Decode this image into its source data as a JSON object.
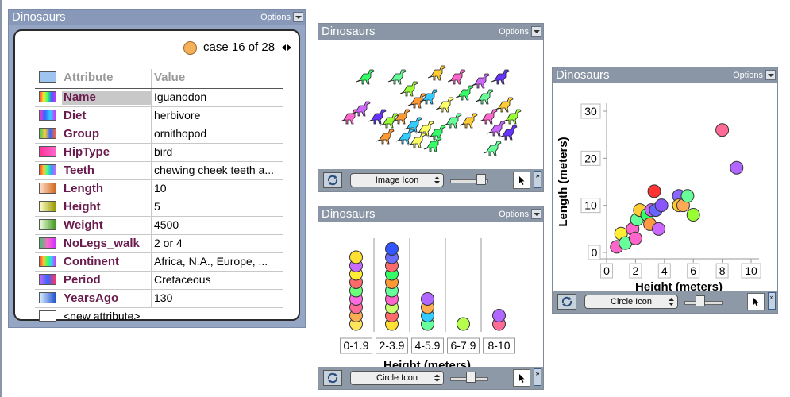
{
  "case_card": {
    "title": "Dinosaurs",
    "options_label": "Options",
    "case_text": "case 16 of 28",
    "header": {
      "attribute": "Attribute",
      "value": "Value"
    },
    "rows": [
      {
        "name": "Name",
        "value": "Iguanodon",
        "swatch": [
          "#ff3333",
          "#ffee33",
          "#33ff66",
          "#3366ff",
          "#cc33ff"
        ]
      },
      {
        "name": "Diet",
        "value": "herbivore",
        "swatch": [
          "#ff33cc",
          "#3366ff",
          "#33ccff",
          "#cc33ff"
        ]
      },
      {
        "name": "Group",
        "value": "ornithopod",
        "swatch": [
          "#33cc66",
          "#ffcc33",
          "#3366ff",
          "#ff6633"
        ]
      },
      {
        "name": "HipType",
        "value": "bird",
        "swatch": [
          "#ff3399",
          "#ff66cc"
        ]
      },
      {
        "name": "Teeth",
        "value": "chewing cheek teeth a...",
        "swatch": [
          "#ff3333",
          "#ffcc33",
          "#33ff99",
          "#3399ff",
          "#cc66ff"
        ]
      },
      {
        "name": "Length",
        "value": "10",
        "swatch": [
          "#ffe0cc",
          "#d2691e"
        ]
      },
      {
        "name": "Height",
        "value": "5",
        "swatch": [
          "#ffffcc",
          "#999900"
        ]
      },
      {
        "name": "Weight",
        "value": "4500",
        "swatch": [
          "#eeffdd",
          "#449922"
        ]
      },
      {
        "name": "NoLegs_walk",
        "value": "2 or 4",
        "swatch": [
          "#33cc66",
          "#ff66cc",
          "#cc33ff"
        ]
      },
      {
        "name": "Continent",
        "value": "Africa, N.A., Europe, ...",
        "swatch": [
          "#ff3333",
          "#ffcc33",
          "#33ff66",
          "#33ccff",
          "#cc33ff"
        ]
      },
      {
        "name": "Period",
        "value": "Cretaceous",
        "swatch": [
          "#cc66ff",
          "#3366ff",
          "#ff3366"
        ]
      },
      {
        "name": "YearsAgo",
        "value": "130",
        "swatch": [
          "#ddeeff",
          "#2255cc"
        ]
      }
    ],
    "new_attribute": "<new attribute>"
  },
  "image_panel": {
    "title": "Dinosaurs",
    "options_label": "Options",
    "select_value": "Image Icon",
    "colors": [
      "#33ff66",
      "#66ff99",
      "#ffcc33",
      "#ff66cc",
      "#cc66ff",
      "#6633ff",
      "#99ff33",
      "#ff9933",
      "#33ccff",
      "#ffff66"
    ]
  },
  "dot_chart": {
    "title": "Dinosaurs",
    "options_label": "Options",
    "select_value": "Circle Icon",
    "xlabel": "Height (meters)",
    "bins": [
      {
        "label": "0-1.9",
        "dots": [
          "#ffe55c",
          "#ffae52",
          "#ff6b96",
          "#ff6be0",
          "#6bff7a",
          "#ff6b6b",
          "#ffee33",
          "#c96bff",
          "#ffe033"
        ]
      },
      {
        "label": "2-3.9",
        "dots": [
          "#ffe033",
          "#ff6b6b",
          "#c9ff6b",
          "#ff66cc",
          "#66ff99",
          "#ff9933",
          "#33ff66",
          "#ff6b6b",
          "#6b6bff",
          "#3355ff"
        ]
      },
      {
        "label": "4-5.9",
        "dots": [
          "#66ff99",
          "#33ccff",
          "#ffae52",
          "#b066ff"
        ]
      },
      {
        "label": "6-7.9",
        "dots": [
          "#b6ff4d"
        ]
      },
      {
        "label": "8-10",
        "dots": [
          "#ff6b96",
          "#b066ff"
        ]
      }
    ]
  },
  "scatter_chart": {
    "title": "Dinosaurs",
    "options_label": "Options",
    "select_value": "Circle Icon",
    "chart_data": {
      "type": "scatter",
      "xlabel": "Height (meters)",
      "ylabel": "Length (meters)",
      "xlim": [
        0,
        10
      ],
      "ylim": [
        0,
        30
      ],
      "xticks": [
        0,
        2,
        4,
        6,
        8,
        10
      ],
      "yticks": [
        0,
        10,
        20,
        30
      ],
      "points": [
        {
          "x": 0.7,
          "y": 1.2,
          "color": "#ff66cc"
        },
        {
          "x": 1.0,
          "y": 4.0,
          "color": "#ffee33"
        },
        {
          "x": 1.3,
          "y": 2.0,
          "color": "#66ff99"
        },
        {
          "x": 1.8,
          "y": 5.0,
          "color": "#ff66cc"
        },
        {
          "x": 2.0,
          "y": 3.0,
          "color": "#ff66cc"
        },
        {
          "x": 2.1,
          "y": 7.0,
          "color": "#66ff99"
        },
        {
          "x": 2.3,
          "y": 9.0,
          "color": "#ffcc33"
        },
        {
          "x": 2.8,
          "y": 8.0,
          "color": "#33ff66"
        },
        {
          "x": 3.0,
          "y": 6.0,
          "color": "#ff9944"
        },
        {
          "x": 3.1,
          "y": 9.0,
          "color": "#cc66ff"
        },
        {
          "x": 3.3,
          "y": 13.0,
          "color": "#ff3333"
        },
        {
          "x": 3.4,
          "y": 9.0,
          "color": "#6666ff"
        },
        {
          "x": 3.6,
          "y": 5.0,
          "color": "#cc66ff"
        },
        {
          "x": 3.8,
          "y": 10.0,
          "color": "#8855ff"
        },
        {
          "x": 5.0,
          "y": 12.0,
          "color": "#8866ff"
        },
        {
          "x": 5.0,
          "y": 10.0,
          "color": "#ffcc33"
        },
        {
          "x": 5.3,
          "y": 10.0,
          "color": "#ffaa55"
        },
        {
          "x": 5.6,
          "y": 12.0,
          "color": "#66ff99"
        },
        {
          "x": 6.0,
          "y": 8.0,
          "color": "#99ff33"
        },
        {
          "x": 8.0,
          "y": 26.0,
          "color": "#ff6b96"
        },
        {
          "x": 9.0,
          "y": 18.0,
          "color": "#b066ff"
        }
      ]
    }
  }
}
